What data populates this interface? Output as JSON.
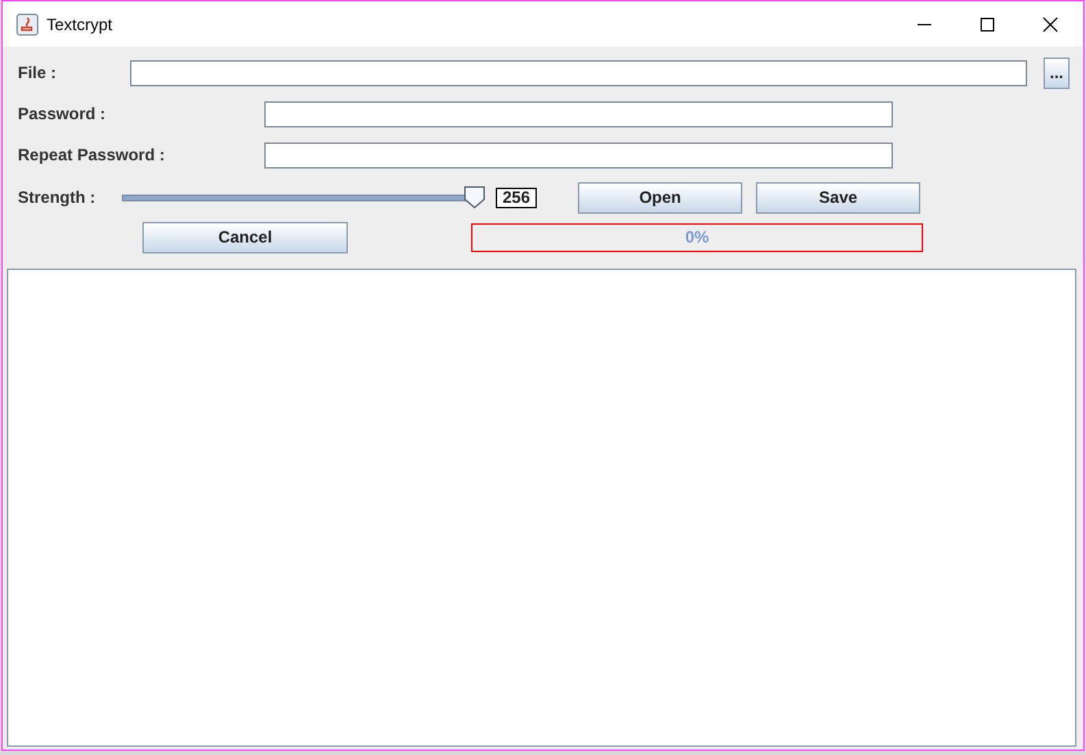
{
  "window": {
    "title": "Textcrypt"
  },
  "file": {
    "label": "File :",
    "browse_button": "..."
  },
  "password": {
    "label": "Password :"
  },
  "repeat_password": {
    "label": "Repeat Password :"
  },
  "strength": {
    "label": "Strength :",
    "level": 1,
    "reading": "256"
  },
  "buttons": {
    "open": "Open",
    "save": "Save",
    "cancel": "Cancel"
  },
  "progress": {
    "level": 0,
    "reading": "0%"
  }
}
